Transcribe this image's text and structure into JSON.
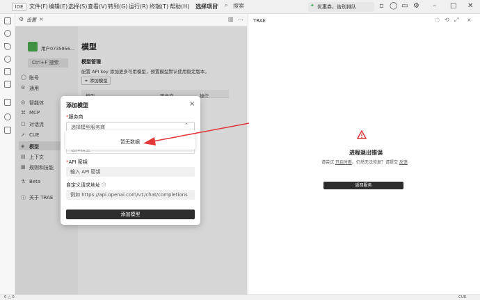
{
  "titlebar": {
    "ide": "IDE",
    "menus": [
      "文件(F)",
      "编辑(E)",
      "选择(S)",
      "查看(V)",
      "转到(G)",
      "运行(R)",
      "终端(T)",
      "帮助(H)"
    ],
    "project": "选择项目",
    "search": "搜索",
    "notice": "优惠券，告别排队"
  },
  "tabs": {
    "settings": "设置"
  },
  "user": {
    "name": "用户0735956..."
  },
  "sidebar": {
    "search": "Ctrl+F 搜索",
    "items": [
      "账号",
      "通用",
      "智能体",
      "MCP",
      "对话流",
      "CUE",
      "模型",
      "上下文",
      "规则和技能",
      "Beta",
      "关于 TRAE"
    ]
  },
  "content": {
    "title": "模型",
    "subtitle": "模型管理",
    "desc": "配置 API key 添加更多可用模型，预置模型默认使用稳定版本。",
    "add_button": "+ 添加模型",
    "columns": [
      "模型",
      "服务商",
      "操作"
    ]
  },
  "modal": {
    "title": "添加模型",
    "provider_label": "服务商",
    "provider_placeholder": "选择模型服务商",
    "model_placeholder": "选择模型",
    "empty": "暂无数据",
    "apikey_label": "API 密钥",
    "apikey_placeholder": "输入 API 密钥",
    "url_label": "自定义请求地址",
    "url_placeholder": "例如 https://api.openai.com/v1/chat/completions",
    "submit": "添加模型"
  },
  "right": {
    "title": "TRAE",
    "error_title": "进程退出错误",
    "error_pre": "请尝试",
    "error_restart": "开启时断",
    "error_mid": "。仍然无法恢复？请提交",
    "error_feedback": "反馈",
    "back": "返回服务"
  },
  "status": {
    "left": "0 △ 0",
    "right": "CUE"
  },
  "colors": {
    "accent": "#2d2d2d",
    "required": "#e0352b",
    "arrow": "#e5383b",
    "error_icon": "#d93a3a"
  }
}
